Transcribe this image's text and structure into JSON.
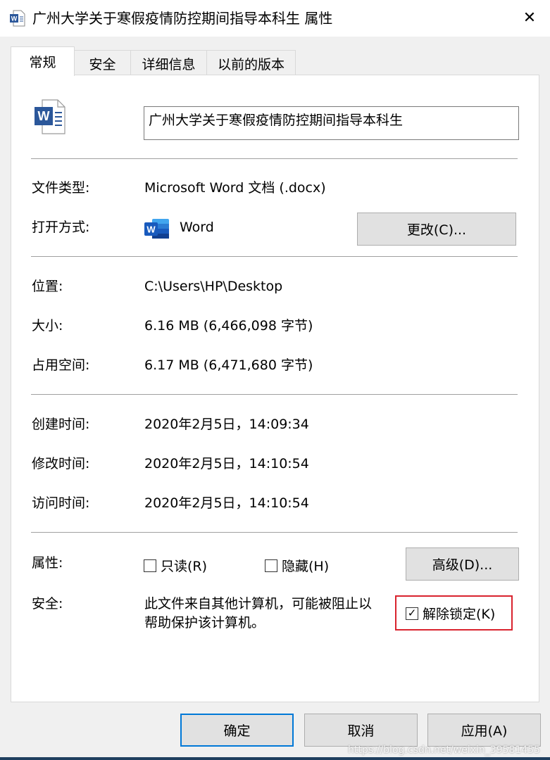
{
  "window": {
    "title": "广州大学关于寒假疫情防控期间指导本科生 属性",
    "close_glyph": "✕"
  },
  "tabs": [
    {
      "label": "常规",
      "active": true
    },
    {
      "label": "安全",
      "active": false
    },
    {
      "label": "详细信息",
      "active": false
    },
    {
      "label": "以前的版本",
      "active": false
    }
  ],
  "file": {
    "name": "广州大学关于寒假疫情防控期间指导本科生",
    "type_label": "文件类型:",
    "type_value": "Microsoft Word 文档 (.docx)",
    "open_with_label": "打开方式:",
    "open_with_value": "Word",
    "change_button": "更改(C)...",
    "location_label": "位置:",
    "location_value": "C:\\Users\\HP\\Desktop",
    "size_label": "大小:",
    "size_value": "6.16 MB (6,466,098 字节)",
    "disk_size_label": "占用空间:",
    "disk_size_value": "6.17 MB (6,471,680 字节)",
    "created_label": "创建时间:",
    "created_value": "2020年2月5日，14:09:34",
    "modified_label": "修改时间:",
    "modified_value": "2020年2月5日，14:10:54",
    "accessed_label": "访问时间:",
    "accessed_value": "2020年2月5日，14:10:54"
  },
  "attributes": {
    "label": "属性:",
    "readonly_label": "只读(R)",
    "readonly_checked": false,
    "hidden_label": "隐藏(H)",
    "hidden_checked": false,
    "advanced_button": "高级(D)..."
  },
  "security": {
    "label": "安全:",
    "message_line1": "此文件来自其他计算机，可能被阻止以",
    "message_line2": "帮助保护该计算机。",
    "unblock_label": "解除锁定(K)",
    "unblock_checked": true,
    "check_glyph": "✓"
  },
  "footer": {
    "ok_button": "确定",
    "cancel_button": "取消",
    "apply_button": "应用(A)"
  },
  "watermark": "https://blog.csdn.net/weixin_39581455",
  "colors": {
    "word_blue": "#2b579a",
    "focus_border": "#0078d7",
    "highlight_red": "#d9232e"
  }
}
